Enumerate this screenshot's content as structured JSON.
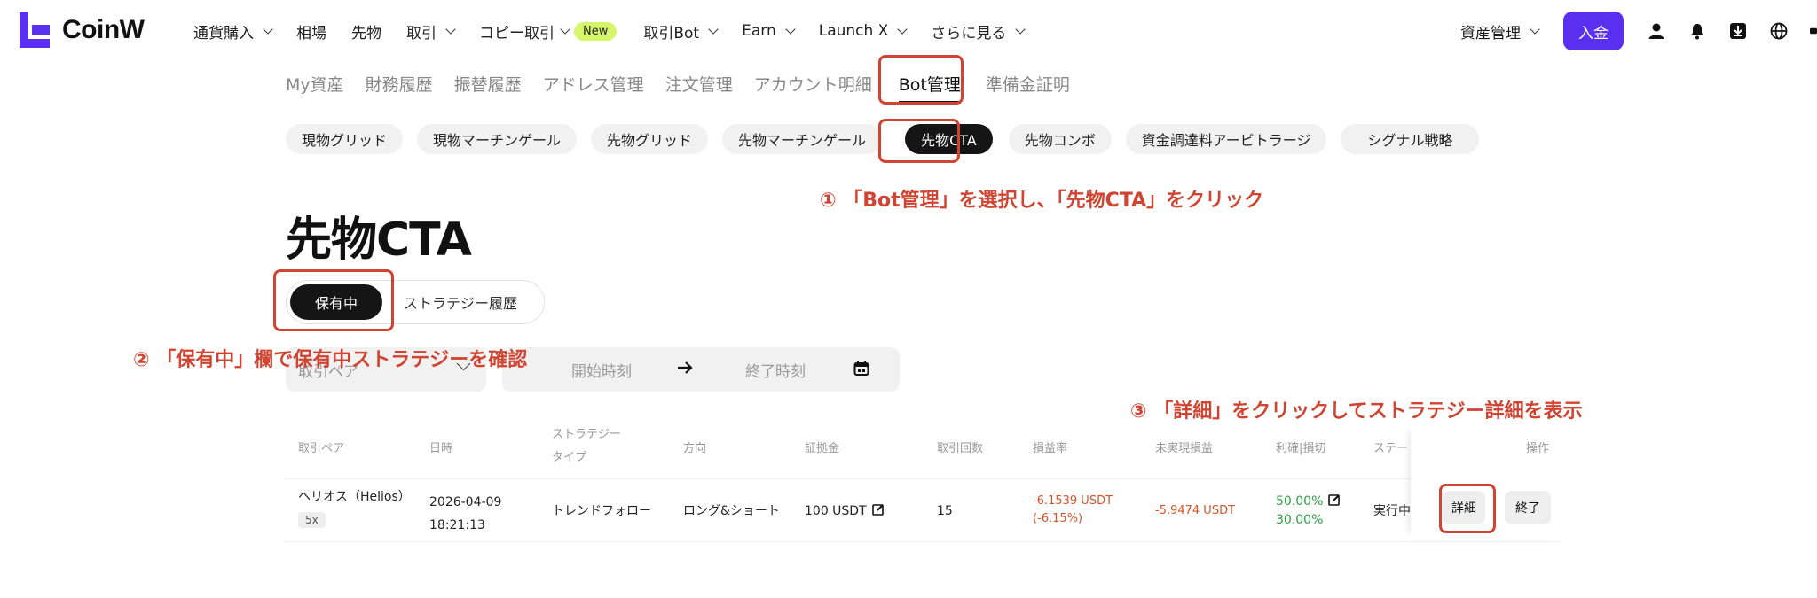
{
  "brand": {
    "name": "CoinW",
    "accent": "#5b2ff0"
  },
  "topnav": {
    "items": [
      {
        "label": "通貨購入",
        "has_dropdown": true
      },
      {
        "label": "相場",
        "has_dropdown": false
      },
      {
        "label": "先物",
        "has_dropdown": false
      },
      {
        "label": "取引",
        "has_dropdown": true
      },
      {
        "label": "コピー取引",
        "has_dropdown": true,
        "badge": "New"
      },
      {
        "label": "取引Bot",
        "has_dropdown": true
      },
      {
        "label": "Earn",
        "has_dropdown": true
      },
      {
        "label": "Launch X",
        "has_dropdown": true
      },
      {
        "label": "さらに見る",
        "has_dropdown": true
      }
    ],
    "asset_management": "資産管理",
    "deposit": "入金",
    "icons": [
      "user-icon",
      "bell-icon",
      "download-icon",
      "globe-icon"
    ]
  },
  "subtabs": [
    "My資産",
    "財務履歴",
    "振替履歴",
    "アドレス管理",
    "注文管理",
    "アカウント明細",
    "Bot管理",
    "準備金証明"
  ],
  "subtabs_active": "Bot管理",
  "bot_types": [
    "現物グリッド",
    "現物マーチンゲール",
    "先物グリッド",
    "先物マーチンゲール",
    "先物CTA",
    "先物コンボ",
    "資金調達料アービトラージ",
    "シグナル戦略"
  ],
  "bot_types_active": "先物CTA",
  "page_title": "先物CTA",
  "holding_toggle": {
    "active": "保有中",
    "other": "ストラテジー履歴"
  },
  "filters": {
    "pair_placeholder": "取引ペア",
    "start_placeholder": "開始時刻",
    "end_placeholder": "終了時刻"
  },
  "table": {
    "headers": [
      "取引ペア",
      "日時",
      "ストラテジータイプ",
      "方向",
      "証拠金",
      "取引回数",
      "損益率",
      "未実現損益",
      "利確|損切",
      "ステー",
      "操作"
    ],
    "rows": [
      {
        "pair": "ヘリオス（Helios）",
        "leverage": "5x",
        "date": "2026-04-09",
        "time": "18:21:13",
        "type": "トレンドフォロー",
        "direction": "ロング&ショート",
        "margin": "100 USDT",
        "trades": "15",
        "pnl_rate": "-6.1539 USDT",
        "pnl_rate_pct": "(-6.15%)",
        "unrealized": "-5.9474 USDT",
        "take_profit": "50.00%",
        "stop_loss": "30.00%",
        "status": "実行中",
        "details_btn": "詳細",
        "end_btn": "終了"
      }
    ]
  },
  "annotations": {
    "step1": "① 「Bot管理」を選択し、「先物CTA」をクリック",
    "step2": "② 「保有中」欄で保有中ストラテジーを確認",
    "step3": "③ 「詳細」をクリックしてストラテジー詳細を表示",
    "color": "#d04432"
  },
  "colors": {
    "negative": "#d2552b",
    "positive": "#2f9e44",
    "pill_active": "#151515"
  }
}
